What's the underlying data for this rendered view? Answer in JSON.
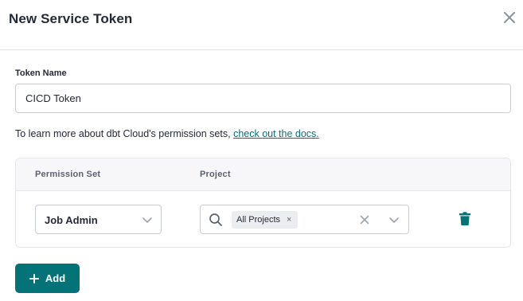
{
  "modal": {
    "title": "New Service Token",
    "close_icon": "close-icon"
  },
  "token": {
    "label": "Token Name",
    "value": "CICD Token"
  },
  "info": {
    "text": "To learn more about dbt Cloud's permission sets, ",
    "link": "check out the docs."
  },
  "permissions": {
    "columns": [
      "Permission Set",
      "Project"
    ],
    "rows": [
      {
        "permission_set": "Job Admin",
        "project_chip": "All Projects",
        "chip_remove": "×"
      }
    ]
  },
  "actions": {
    "add_label": "Add",
    "add_icon": "plus-icon",
    "delete_icon": "trash-icon"
  },
  "colors": {
    "accent": "#047377",
    "border": "#c8ccd4",
    "header_bg": "#f7f7f9",
    "text": "#262a38"
  }
}
